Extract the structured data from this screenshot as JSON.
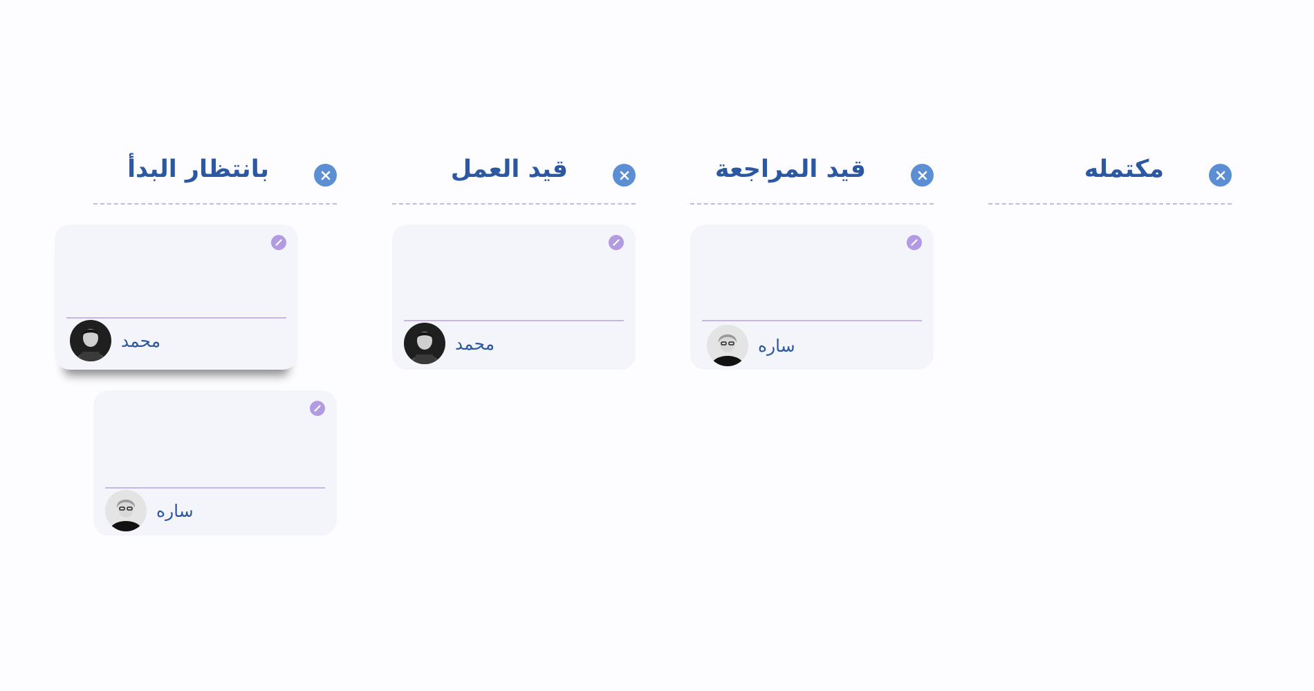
{
  "colors": {
    "title": "#2b58a0",
    "close_button": "#5b8ed3",
    "edit_button": "#b39be3",
    "divider": "#c7b4e8",
    "card_bg": "#f4f5fa"
  },
  "columns": [
    {
      "title": "بانتظار البدأ",
      "close_icon": "close-icon",
      "cards": [
        {
          "assignee": "محمد",
          "avatar": "man-avatar",
          "edit_icon": "pencil-icon"
        },
        {
          "assignee": "ساره",
          "avatar": "woman-avatar",
          "edit_icon": "pencil-icon"
        }
      ]
    },
    {
      "title": "قيد العمل",
      "close_icon": "close-icon",
      "cards": [
        {
          "assignee": "محمد",
          "avatar": "man-avatar",
          "edit_icon": "pencil-icon"
        }
      ]
    },
    {
      "title": "قيد المراجعة",
      "close_icon": "close-icon",
      "cards": [
        {
          "assignee": "ساره",
          "avatar": "woman-avatar",
          "edit_icon": "pencil-icon"
        }
      ]
    },
    {
      "title": "مكتمله",
      "close_icon": "close-icon",
      "cards": []
    }
  ]
}
